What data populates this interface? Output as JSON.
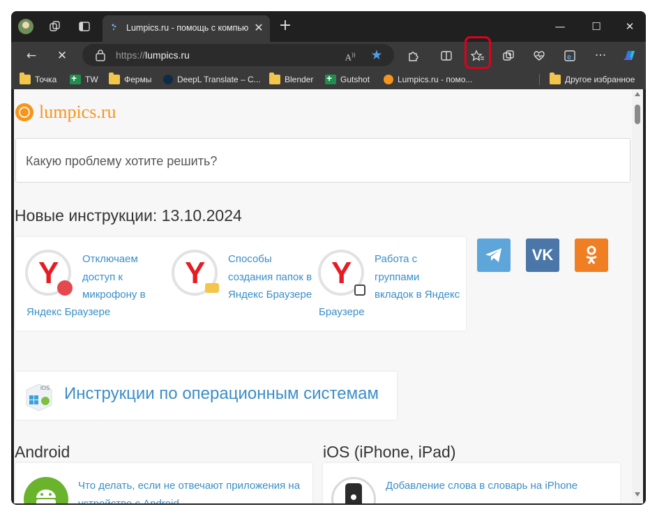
{
  "browser": {
    "tab": {
      "title": "Lumpics.ru - помощь с компьютером"
    },
    "address": {
      "scheme": "https://",
      "host": "lumpics.ru"
    },
    "read_aloud_label": "A̅",
    "bookmarks": [
      {
        "label": "Точка",
        "icon": "folder-icon"
      },
      {
        "label": "TW",
        "icon": "sheets-icon"
      },
      {
        "label": "Фермы",
        "icon": "folder-icon"
      },
      {
        "label": "DeepL Translate – C...",
        "icon": "deepl-icon"
      },
      {
        "label": "Blender",
        "icon": "folder-icon"
      },
      {
        "label": "Gutshot",
        "icon": "sheets-icon"
      },
      {
        "label": "Lumpics.ru - помо...",
        "icon": "lumpics-icon"
      }
    ],
    "other_favorites": "Другое избранное",
    "highlight_color": "#e0001b"
  },
  "page": {
    "logo_text": "lumpics.ru",
    "search_placeholder": "Какую проблему хотите решить?",
    "news_heading": "Новые инструкции: 13.10.2024",
    "news": [
      {
        "lines": [
          "Отключаем",
          "доступ к",
          "микрофону в",
          "Яндекс Браузере"
        ]
      },
      {
        "lines": [
          "Способы",
          "создания папок в",
          "Яндекс Браузере"
        ]
      },
      {
        "lines": [
          "Работа с",
          "группами",
          "вкладок в Яндекс",
          "Браузере"
        ]
      }
    ],
    "social": [
      {
        "name": "telegram",
        "color": "#5ea6d9"
      },
      {
        "name": "vk",
        "label": "VK",
        "color": "#4a76a8"
      },
      {
        "name": "odnoklassniki",
        "color": "#f07e22"
      }
    ],
    "os_section_title": "Инструкции по операционным системам",
    "os_icon_label": "iOS",
    "android": {
      "heading": "Android",
      "article_lines": [
        "Что делать, если не отвечают приложения на",
        "устройстве с Android"
      ]
    },
    "ios": {
      "heading": "iOS (iPhone, iPad)",
      "article_lines": [
        "Добавление слова в словарь на iPhone"
      ]
    },
    "brand_color": "#f7941d",
    "link_color": "#3a8ec8"
  }
}
